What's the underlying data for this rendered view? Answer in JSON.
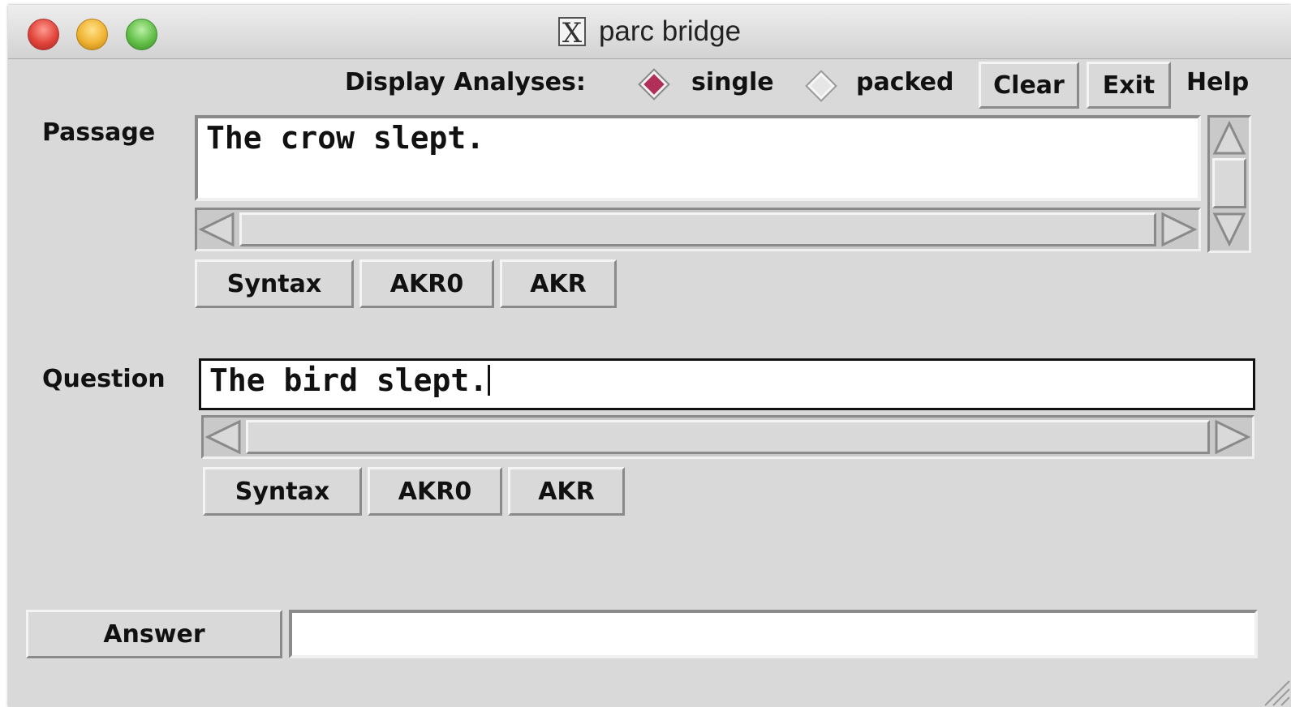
{
  "window": {
    "title": "parc bridge"
  },
  "toolbar": {
    "display_label": "Display Analyses:",
    "radio_single": "single",
    "radio_packed": "packed",
    "selected": "single",
    "clear_label": "Clear",
    "exit_label": "Exit",
    "help_label": "Help"
  },
  "passage": {
    "label": "Passage",
    "text": "The crow slept.",
    "buttons": [
      "Syntax",
      "AKR0",
      "AKR"
    ]
  },
  "question": {
    "label": "Question",
    "text": "The bird slept.",
    "buttons": [
      "Syntax",
      "AKR0",
      "AKR"
    ]
  },
  "answer": {
    "button_label": "Answer",
    "value": ""
  },
  "colors": {
    "radio_selected": "#b0305a",
    "background": "#d9d9d9"
  }
}
